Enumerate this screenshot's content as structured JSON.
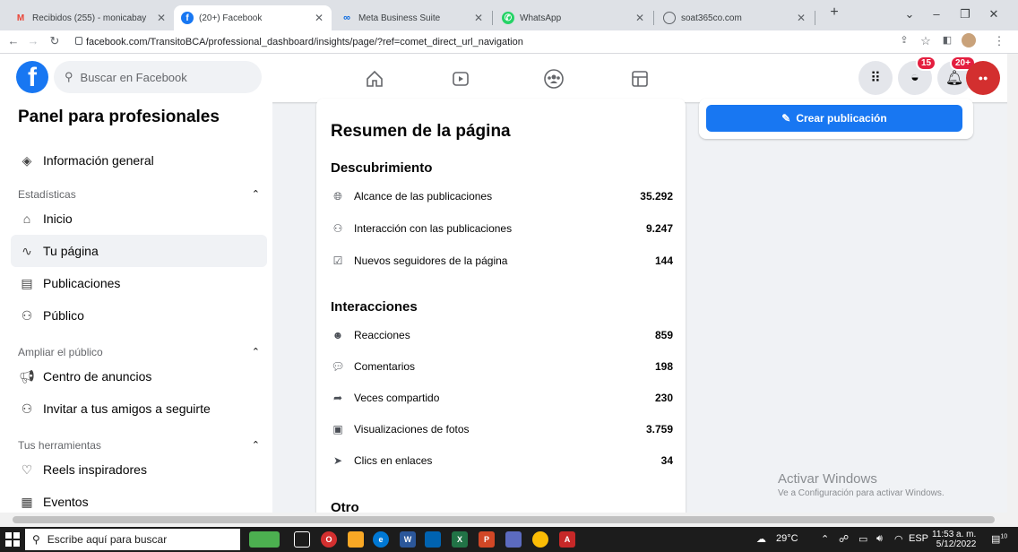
{
  "browser": {
    "tabs": [
      {
        "icon": "gmail-icon",
        "title": "Recibidos (255) - monicabay",
        "active": false
      },
      {
        "icon": "facebook-icon",
        "title": "(20+) Facebook",
        "active": true
      },
      {
        "icon": "meta-icon",
        "title": "Meta Business Suite",
        "active": false
      },
      {
        "icon": "whatsapp-icon",
        "title": "WhatsApp",
        "active": false
      },
      {
        "icon": "globe-icon",
        "title": "soat365co.com",
        "active": false
      }
    ],
    "url": "facebook.com/TransitoBCA/professional_dashboard/insights/page/?ref=comet_direct_url_navigation"
  },
  "header": {
    "search_placeholder": "Buscar en Facebook",
    "messenger_badge": "15",
    "notifications_badge": "20+"
  },
  "sidebar": {
    "title": "Panel para profesionales",
    "overview": "Información general",
    "section_stats": "Estadísticas",
    "stats_items": [
      "Inicio",
      "Tu página",
      "Publicaciones",
      "Público"
    ],
    "section_audience": "Ampliar el público",
    "audience_items": [
      "Centro de anuncios",
      "Invitar a tus amigos a seguirte"
    ],
    "section_tools": "Tus herramientas",
    "tools_items": [
      "Reels inspiradores",
      "Eventos"
    ]
  },
  "summary": {
    "title": "Resumen de la página",
    "discovery_title": "Descubrimiento",
    "discovery": [
      {
        "label": "Alcance de las publicaciones",
        "value": "35.292",
        "icon": "globe-icon"
      },
      {
        "label": "Interacción con las publicaciones",
        "value": "9.247",
        "icon": "people-icon"
      },
      {
        "label": "Nuevos seguidores de la página",
        "value": "144",
        "icon": "check-icon"
      }
    ],
    "interactions_title": "Interacciones",
    "interactions": [
      {
        "label": "Reacciones",
        "value": "859",
        "icon": "smiley-icon"
      },
      {
        "label": "Comentarios",
        "value": "198",
        "icon": "comment-icon"
      },
      {
        "label": "Veces compartido",
        "value": "230",
        "icon": "share-icon"
      },
      {
        "label": "Visualizaciones de fotos",
        "value": "3.759",
        "icon": "photo-icon"
      },
      {
        "label": "Clics en enlaces",
        "value": "34",
        "icon": "cursor-icon"
      }
    ],
    "other_title": "Otro"
  },
  "right": {
    "create_post": "Crear publicación"
  },
  "watermark": {
    "line1": "Activar Windows",
    "line2": "Ve a Configuración para activar Windows."
  },
  "taskbar": {
    "search_placeholder": "Escribe aquí para buscar",
    "weather": "29°C",
    "lang": "ESP",
    "time": "11:53 a. m.",
    "date": "5/12/2022",
    "notif_count": "10"
  }
}
